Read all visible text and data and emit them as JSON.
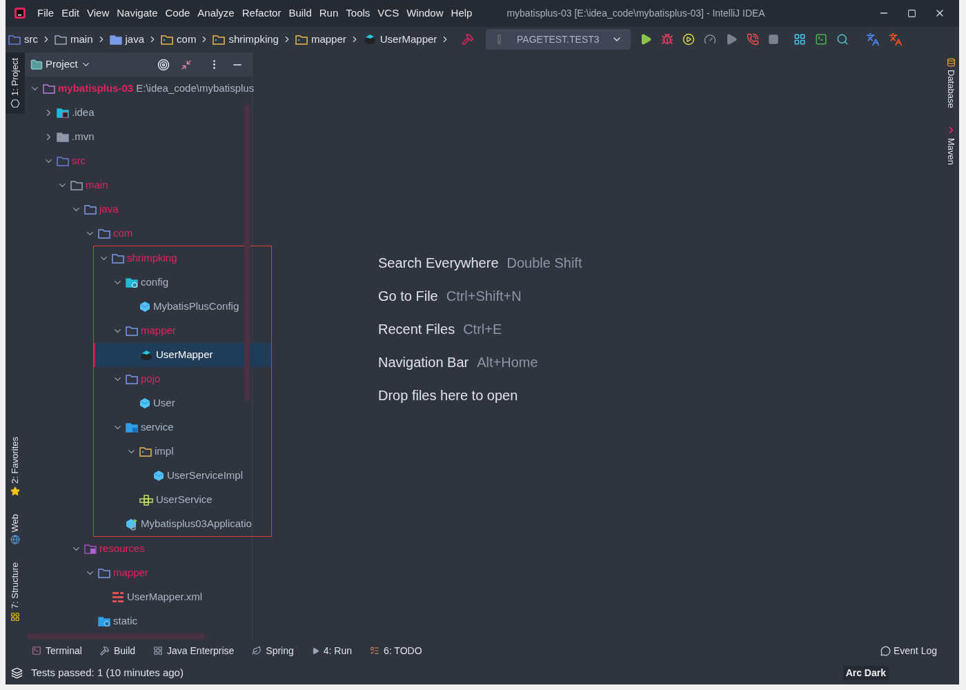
{
  "window": {
    "title": "mybatisplus-03 [E:\\idea_code\\mybatisplus-03] - IntelliJ IDEA"
  },
  "menu": [
    "File",
    "Edit",
    "View",
    "Navigate",
    "Code",
    "Analyze",
    "Refactor",
    "Build",
    "Run",
    "Tools",
    "VCS",
    "Window",
    "Help"
  ],
  "breadcrumbs": [
    {
      "label": "src",
      "kind": "src"
    },
    {
      "label": "main",
      "kind": "plain"
    },
    {
      "label": "java",
      "kind": "source"
    },
    {
      "label": "com",
      "kind": "package"
    },
    {
      "label": "shrimpking",
      "kind": "package"
    },
    {
      "label": "mapper",
      "kind": "package"
    },
    {
      "label": "UserMapper",
      "kind": "mapper"
    }
  ],
  "run_config": {
    "label": "PAGETEST.TEST3"
  },
  "project_panel": {
    "title": "Project",
    "tree": [
      {
        "name": "mybatisplus-03",
        "path": "E:\\idea_code\\mybatisplus",
        "kind": "module",
        "expanded": true,
        "selected": false,
        "color": "#e0245e",
        "children": [
          {
            "name": ".idea",
            "kind": "idea",
            "expanded": false,
            "selected": false,
            "color": "#a9b7c6"
          },
          {
            "name": ".mvn",
            "kind": "grey",
            "expanded": false,
            "selected": false,
            "color": "#a9b7c6"
          },
          {
            "name": "src",
            "kind": "src",
            "expanded": true,
            "selected": false,
            "color": "#e0245e",
            "children": [
              {
                "name": "main",
                "kind": "plain",
                "expanded": true,
                "selected": false,
                "color": "#e0245e",
                "children": [
                  {
                    "name": "java",
                    "kind": "outline",
                    "expanded": true,
                    "selected": false,
                    "color": "#e0245e",
                    "children": [
                      {
                        "name": "com",
                        "kind": "outline",
                        "expanded": true,
                        "selected": false,
                        "color": "#e0245e",
                        "children": [
                          {
                            "name": "shrimpking",
                            "kind": "outline",
                            "expanded": true,
                            "selected": false,
                            "framed": true,
                            "color": "#e0245e",
                            "children": [
                              {
                                "name": "config",
                                "kind": "config",
                                "expanded": true,
                                "selected": false,
                                "color": "#a9b7c6",
                                "children": [
                                  {
                                    "name": "MybatisPlusConfig",
                                    "kind": "class",
                                    "selected": false,
                                    "color": "#a9b7c6"
                                  }
                                ]
                              },
                              {
                                "name": "mapper",
                                "kind": "outline",
                                "expanded": true,
                                "selected": false,
                                "color": "#e0245e",
                                "children": [
                                  {
                                    "name": "UserMapper",
                                    "kind": "mapper",
                                    "selected": true,
                                    "color": "#ffffff"
                                  }
                                ]
                              },
                              {
                                "name": "pojo",
                                "kind": "outline",
                                "expanded": true,
                                "selected": false,
                                "color": "#e0245e",
                                "children": [
                                  {
                                    "name": "User",
                                    "kind": "class",
                                    "selected": false,
                                    "color": "#a9b7c6"
                                  }
                                ]
                              },
                              {
                                "name": "service",
                                "kind": "service",
                                "expanded": true,
                                "selected": false,
                                "color": "#a9b7c6",
                                "children": [
                                  {
                                    "name": "impl",
                                    "kind": "package",
                                    "expanded": true,
                                    "selected": false,
                                    "color": "#a9b7c6",
                                    "children": [
                                      {
                                        "name": "UserServiceImpl",
                                        "kind": "class",
                                        "selected": false,
                                        "color": "#a9b7c6"
                                      }
                                    ]
                                  },
                                  {
                                    "name": "UserService",
                                    "kind": "interface",
                                    "selected": false,
                                    "color": "#a9b7c6"
                                  }
                                ]
                              },
                              {
                                "name": "Mybatisplus03Applicatio",
                                "kind": "app",
                                "selected": false,
                                "color": "#a9b7c6"
                              }
                            ]
                          }
                        ]
                      }
                    ]
                  },
                  {
                    "name": "resources",
                    "kind": "resources",
                    "expanded": true,
                    "selected": false,
                    "color": "#e0245e",
                    "children": [
                      {
                        "name": "mapper",
                        "kind": "outline",
                        "expanded": true,
                        "selected": false,
                        "color": "#e0245e",
                        "children": [
                          {
                            "name": "UserMapper.xml",
                            "kind": "xml",
                            "selected": false,
                            "color": "#a9b7c6"
                          }
                        ]
                      },
                      {
                        "name": "static",
                        "kind": "static",
                        "selected": false,
                        "color": "#a9b7c6"
                      }
                    ]
                  }
                ]
              }
            ]
          }
        ]
      }
    ]
  },
  "left_tool_windows": [
    {
      "label": "1: Project",
      "kind": "project",
      "selected": true
    },
    {
      "label": "2: Favorites",
      "kind": "favorites",
      "selected": false
    },
    {
      "label": "Web",
      "kind": "web",
      "selected": false
    },
    {
      "label": "7: Structure",
      "kind": "structure",
      "selected": false
    }
  ],
  "right_tool_windows": [
    {
      "label": "Database",
      "kind": "database"
    },
    {
      "label": "Maven",
      "kind": "maven"
    }
  ],
  "editor_hints": [
    {
      "action": "Search Everywhere",
      "shortcut": "Double Shift"
    },
    {
      "action": "Go to File",
      "shortcut": "Ctrl+Shift+N"
    },
    {
      "action": "Recent Files",
      "shortcut": "Ctrl+E"
    },
    {
      "action": "Navigation Bar",
      "shortcut": "Alt+Home"
    },
    {
      "action": "Drop files here to open"
    }
  ],
  "bottom_tools": [
    {
      "label": "Terminal",
      "kind": "terminal"
    },
    {
      "label": "Build",
      "kind": "build"
    },
    {
      "label": "Java Enterprise",
      "kind": "enterprise"
    },
    {
      "label": "Spring",
      "kind": "spring"
    },
    {
      "label": "4: Run",
      "kind": "run"
    },
    {
      "label": "6: TODO",
      "kind": "todo"
    }
  ],
  "event_log": "Event Log",
  "status_bar": {
    "message": "Tests passed: 1 (10 minutes ago)",
    "theme": "Arc Dark"
  }
}
